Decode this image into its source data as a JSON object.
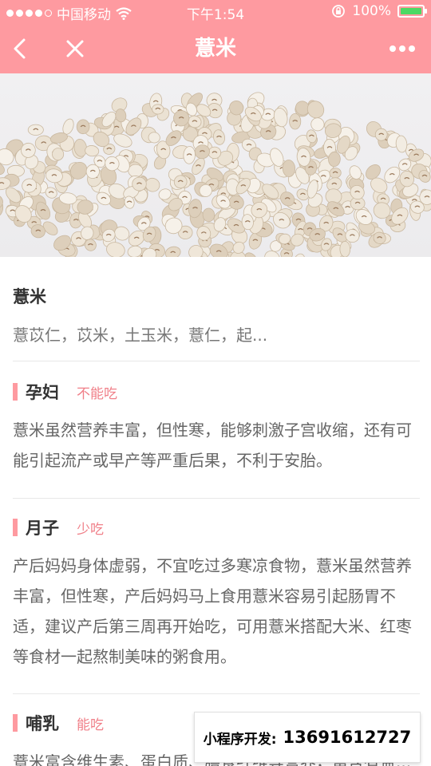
{
  "status_bar": {
    "carrier": "中国移动",
    "time": "下午1:54",
    "battery_text": "100%",
    "battery_level": 1.0,
    "signal_bars_filled": 4,
    "signal_bars_total": 5
  },
  "nav": {
    "title": "薏米",
    "back_icon": "chevron-left-icon",
    "close_icon": "close-icon",
    "more_icon": "more-dots-icon"
  },
  "colors": {
    "header": "#fe9aa0",
    "verdict_text": "#f07f88",
    "battery_fill": "#4cd964"
  },
  "food": {
    "name": "薏米",
    "aliases": "薏苡仁，苡米，土玉米，薏仁，起..."
  },
  "sections": [
    {
      "label": "孕妇",
      "verdict": "不能吃",
      "text": "薏米虽然营养丰富，但性寒，能够刺激子宫收缩，还有可能引起流产或早产等严重后果，不利于安胎。"
    },
    {
      "label": "月子",
      "verdict": "少吃",
      "text": "产后妈妈身体虚弱，不宜吃过多寒凉食物，薏米虽然营养丰富，但性寒，产后妈妈马上食用薏米容易引起肠胃不适，建议产后第三周再开始吃，可用薏米搭配大米、红枣等食材一起熬制美味的粥食用。"
    },
    {
      "label": "哺乳",
      "verdict": "能吃",
      "text": "薏米富含维生素、蛋白质、膳食纤维等营养，富含有益..."
    }
  ],
  "promo": {
    "label": "小程序开发:",
    "phone": "13691612727"
  }
}
